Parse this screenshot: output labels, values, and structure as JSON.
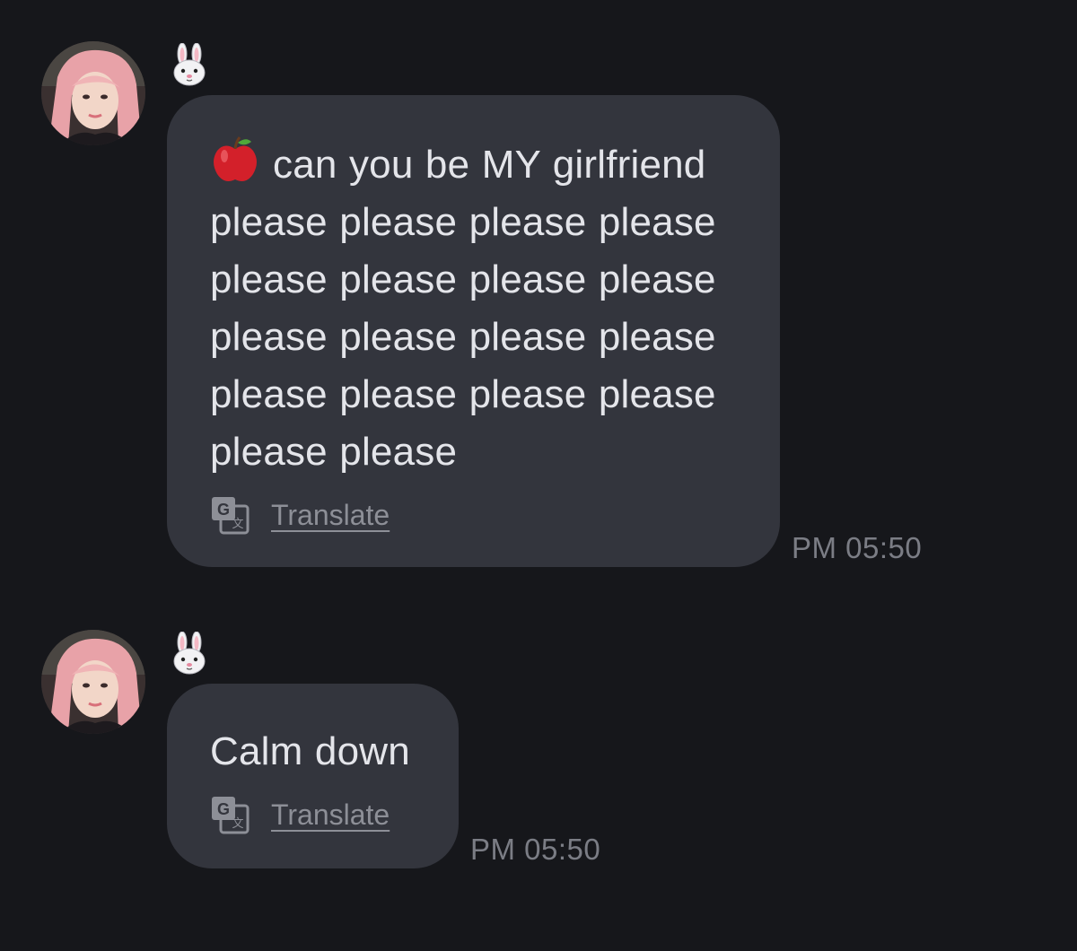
{
  "messages": [
    {
      "sender_emoji": "rabbit-face",
      "emoji_prefix": "red-apple",
      "text": "can you be MY girlfriend",
      "text_continued": "please please please please\nplease please please please\nplease please please please\nplease please please please\nplease please",
      "translate_label": "Translate",
      "time": "PM 05:50"
    },
    {
      "sender_emoji": "rabbit-face",
      "text": "Calm down",
      "translate_label": "Translate",
      "time": "PM 05:50"
    }
  ],
  "colors": {
    "background": "#16171b",
    "bubble": "#33353d",
    "text": "#e4e5ea",
    "muted": "#8d8f97",
    "timestamp": "#7b7d85"
  },
  "icons": {
    "avatar": "profile-photo",
    "sender": "rabbit-face-icon",
    "translate": "google-translate-icon",
    "apple": "red-apple-icon"
  }
}
